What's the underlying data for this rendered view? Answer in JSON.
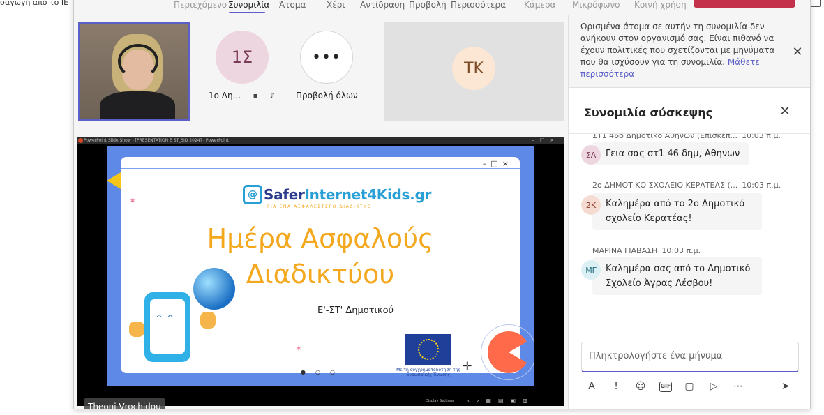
{
  "background": {
    "left_text": "σαγωγή από το IE"
  },
  "topbar": {
    "items": [
      {
        "label": "Περιεχόμενο",
        "state": "dim"
      },
      {
        "label": "Συνομιλία",
        "state": "active"
      },
      {
        "label": "Άτομα",
        "state": "normal"
      },
      {
        "label": "Χέρι",
        "state": "normal"
      },
      {
        "label": "Αντίδραση",
        "state": "normal"
      },
      {
        "label": "Προβολή",
        "state": "normal"
      },
      {
        "label": "Περισσότερα",
        "state": "normal"
      },
      {
        "label": "Κάμερα",
        "state": "dim"
      },
      {
        "label": "Μικρόφωνο",
        "state": "dim"
      },
      {
        "label": "Κοινή χρήση",
        "state": "dim"
      }
    ]
  },
  "tiles": {
    "participant_1_initials": "1Σ",
    "participant_1_label": "1ο Δη...",
    "view_all_glyph": "•••",
    "view_all_label": "Προβολή όλων",
    "participant_tk_initials": "TK"
  },
  "share": {
    "ppt_title": "PowerPoint Slide Show - [PRESENTATION E ST_SID 2024] - PowerPoint",
    "slide": {
      "logo_left": "Safer",
      "logo_right": "Internet4Kids.gr",
      "logo_tagline": "ΓΙΑ ΕΝΑ ΑΣΦΑΛΕΣΤΕΡΟ ΔΙΑΔΙΚΤΥΟ",
      "title_line1": "Ημέρα Ασφαλούς",
      "title_line2": "Διαδικτύου",
      "subtitle": "Ε'-ΣΤ' Δημοτικού",
      "eu_caption": "Με τη συγχρηματοδότηση της Ευρωπαϊκής Ένωσης"
    },
    "footer_display_settings": "Display Settings",
    "presenter_name": "Theoni Vrochidou"
  },
  "panel": {
    "banner_text": "Ορισμένα άτομα σε αυτήν τη συνομιλία δεν ανήκουν στον οργανισμό σας. Είναι πιθανό να έχουν πολιτικές που σχετίζονται με μηνύματα που θα ισχύσουν για τη συνομιλία.",
    "banner_link": "Μάθετε περισσότερα",
    "chat_title": "Συνομιλία σύσκεψης",
    "messages": [
      {
        "sender": "ΣΤ1 46ο Δημοτικό Αθηνών (Επισκέπ...",
        "time": "10:03 π.μ.",
        "initials": "ΣΑ",
        "text": "Γεια σας στ1 46 δημ, Αθηνων",
        "avatar_bg": "#eed6e0",
        "avatar_fg": "#7a3b57"
      },
      {
        "sender": "2ο ΔΗΜΟΤΙΚΟ ΣΧΟΛΕΙΟ ΚΕΡΑΤΕΑΣ (...",
        "time": "10:03 π.μ.",
        "initials": "2Κ",
        "text": "Καλημέρα από το 2ο Δημοτικό σχολείο Κερατέας!",
        "avatar_bg": "#f6dbd2",
        "avatar_fg": "#8a3a24"
      },
      {
        "sender": "ΜΑΡΙΝΑ ΓΙΑΒΑΣΗ",
        "time": "10:03 π.μ.",
        "initials": "ΜΓ",
        "text": "Καλημέρα σας από το Δημοτικό Σχολείο Άγρας Λέσβου!",
        "avatar_bg": "#daf0f4",
        "avatar_fg": "#1f6a78"
      }
    ],
    "compose_placeholder": "Πληκτρολογήστε ένα μήνυμα",
    "tools": [
      "format-icon",
      "priority-icon",
      "emoji-icon",
      "gif-icon",
      "sticker-icon",
      "loop-icon",
      "more-icon",
      "send-icon"
    ],
    "gif_label": "GIF"
  },
  "colors": {
    "accent": "#5b5fc7",
    "leave_button": "#c4314b"
  }
}
